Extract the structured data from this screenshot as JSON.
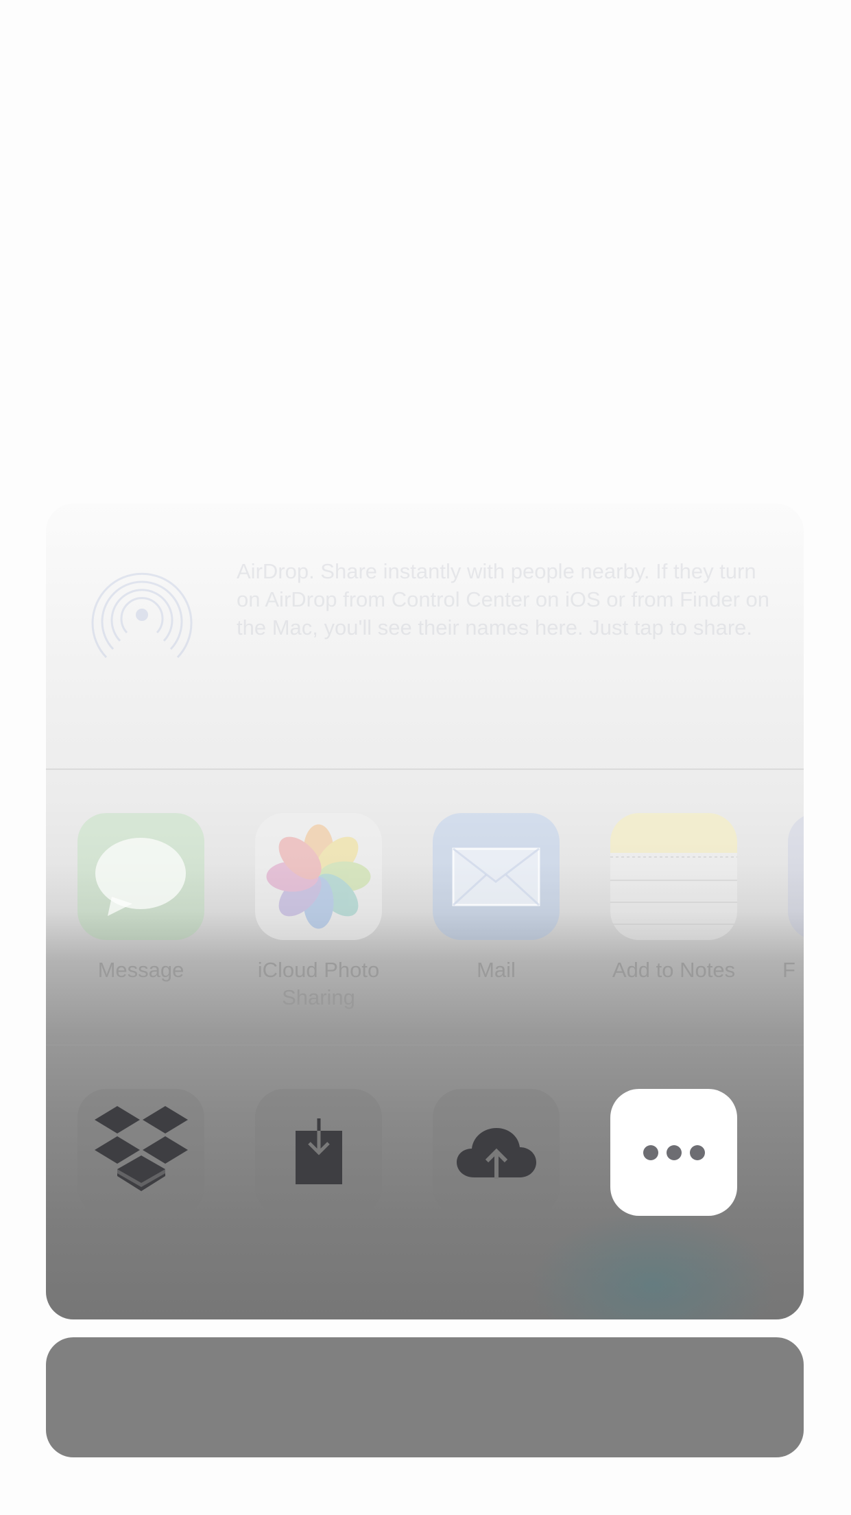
{
  "share_sheet": {
    "airdrop": {
      "icon": "airdrop-icon",
      "description": "AirDrop. Share instantly with people nearby. If they turn on AirDrop from Control Center on iOS or from Finder on the Mac, you'll see their names here. Just tap to share."
    },
    "apps": [
      {
        "label": "Message",
        "icon": "message-icon"
      },
      {
        "label": "iCloud Photo Sharing",
        "icon": "photos-icon"
      },
      {
        "label": "Mail",
        "icon": "mail-icon"
      },
      {
        "label": "Add to Notes",
        "icon": "notes-icon"
      },
      {
        "label": "F",
        "icon": "app-icon"
      }
    ],
    "actions": [
      {
        "name": "dropbox",
        "icon": "dropbox-icon"
      },
      {
        "name": "save",
        "icon": "download-tray-icon"
      },
      {
        "name": "upload",
        "icon": "cloud-upload-icon"
      },
      {
        "name": "more",
        "icon": "more-icon"
      }
    ]
  },
  "cancel_panel": {
    "label": ""
  }
}
